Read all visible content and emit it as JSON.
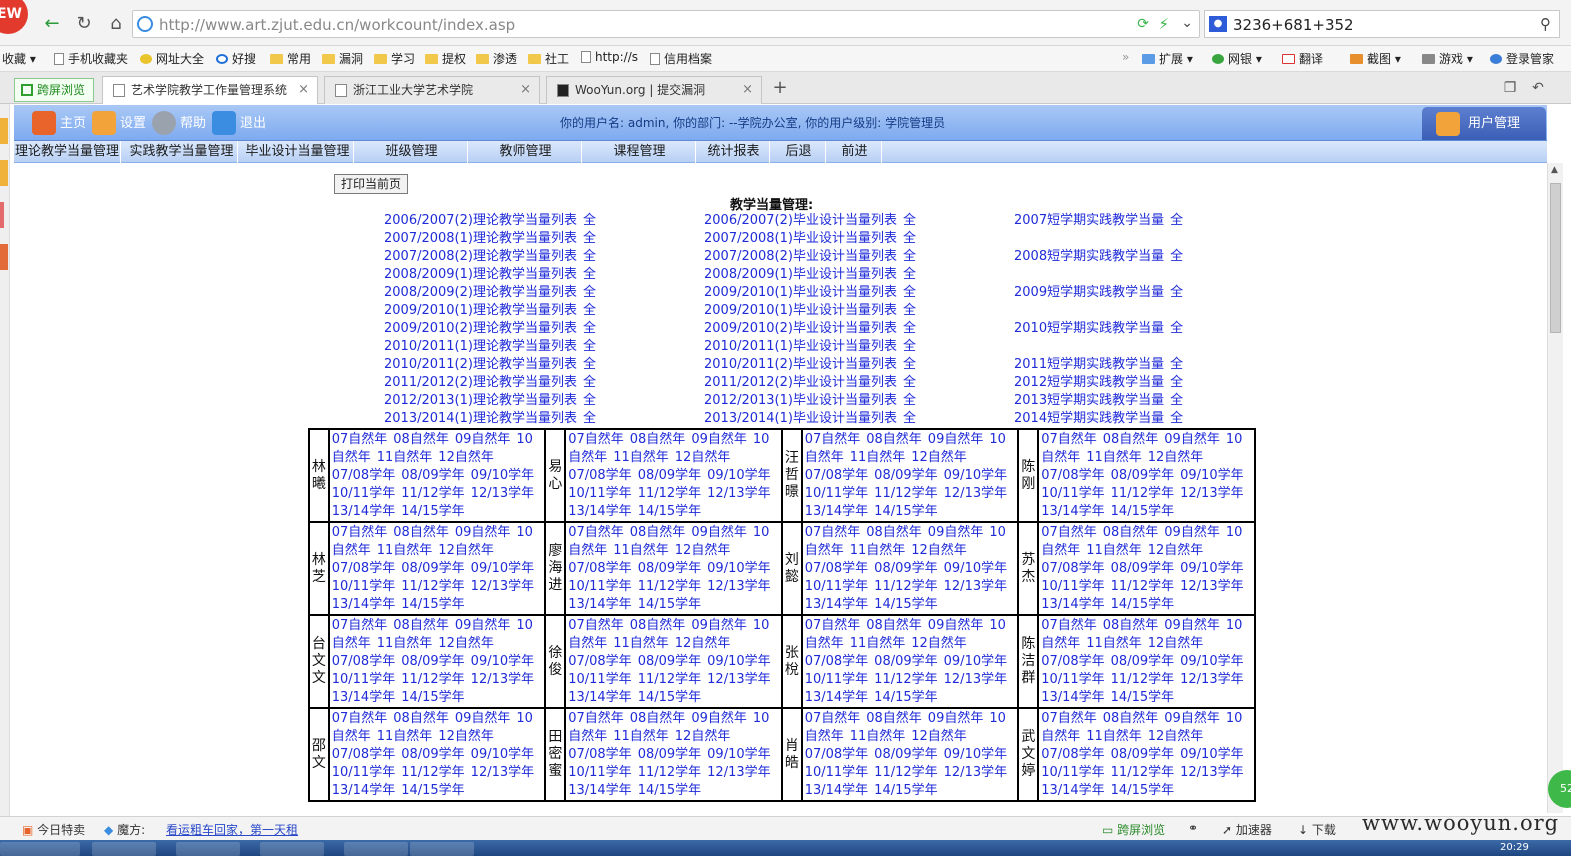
{
  "browser": {
    "url": "http://www.art.zjut.edu.cn/workcount/index.asp",
    "search_text": "3236+681+352",
    "bookmarks": [
      "收藏",
      "手机收藏夹",
      "网址大全",
      "好搜",
      "常用",
      "漏洞",
      "学习",
      "提权",
      "渗透",
      "社工",
      "http://s",
      "信用档案"
    ],
    "right_tools": [
      "扩展",
      "网银",
      "翻译",
      "截图",
      "游戏",
      "登录管家"
    ],
    "kuaping": "跨屏浏览",
    "tabs": [
      {
        "title": "艺术学院教学工作量管理系统",
        "active": true
      },
      {
        "title": "浙江工业大学艺术学院",
        "active": false
      },
      {
        "title": "WooYun.org | 提交漏洞",
        "active": false
      }
    ]
  },
  "app": {
    "header_buttons": [
      "主页",
      "设置",
      "帮助",
      "退出"
    ],
    "user_info": "你的用户名: admin, 你的部门: --学院办公室, 你的用户级别: 学院管理员",
    "user_mgmt": "用户管理",
    "menu": [
      "理论教学当量管理",
      "实践教学当量管理",
      "毕业设计当量管理",
      "班级管理",
      "教师管理",
      "课程管理",
      "统计报表",
      "后退",
      "前进"
    ],
    "print_button": "打印当前页",
    "page_title": "教学当量管理:",
    "all_label": "全",
    "theory_links": [
      "2006/2007(2)理论教学当量列表",
      "2007/2008(1)理论教学当量列表",
      "2007/2008(2)理论教学当量列表",
      "2008/2009(1)理论教学当量列表",
      "2008/2009(2)理论教学当量列表",
      "2009/2010(1)理论教学当量列表",
      "2009/2010(2)理论教学当量列表",
      "2010/2011(1)理论教学当量列表",
      "2010/2011(2)理论教学当量列表",
      "2011/2012(2)理论教学当量列表",
      "2012/2013(1)理论教学当量列表",
      "2013/2014(1)理论教学当量列表"
    ],
    "design_links": [
      "2006/2007(2)毕业设计当量列表",
      "2007/2008(1)毕业设计当量列表",
      "2007/2008(2)毕业设计当量列表",
      "2008/2009(1)毕业设计当量列表",
      "2009/2010(1)毕业设计当量列表",
      "2009/2010(1)毕业设计当量列表",
      "2009/2010(2)毕业设计当量列表",
      "2010/2011(1)毕业设计当量列表",
      "2010/2011(2)毕业设计当量列表",
      "2011/2012(2)毕业设计当量列表",
      "2012/2013(1)毕业设计当量列表",
      "2013/2014(1)毕业设计当量列表"
    ],
    "practice_links": [
      "2007短学期实践教学当量",
      "",
      "2008短学期实践教学当量",
      "",
      "2009短学期实践教学当量",
      "",
      "2010短学期实践教学当量",
      "",
      "2011短学期实践教学当量",
      "2012短学期实践教学当量",
      "2013短学期实践教学当量",
      "2014短学期实践教学当量"
    ],
    "cell_lines": [
      [
        "07自然年",
        "08自然年",
        "09自然年",
        "10"
      ],
      [
        "自然年",
        "11自然年",
        "12自然年"
      ],
      [
        "07/08学年",
        "08/09学年",
        "09/10学年"
      ],
      [
        "10/11学年",
        "11/12学年",
        "12/13学年"
      ],
      [
        "13/14学年",
        "14/15学年"
      ]
    ],
    "teachers": [
      [
        "林曦",
        "易心",
        "汪哲暻",
        "陈刚"
      ],
      [
        "林芝",
        "廖海进",
        "刘懿",
        "苏杰"
      ],
      [
        "台文文",
        "徐俊",
        "张梲",
        "陈洁群"
      ],
      [
        "邵文",
        "田密蜜",
        "肖皓",
        "武文婷"
      ]
    ]
  },
  "status": {
    "items": [
      "今日特卖",
      "魔方:"
    ],
    "news_link": "看运粗车回家，第一天租",
    "right_items": [
      "跨屏浏览",
      "加速器",
      "下载"
    ],
    "watermark": "www.wooyun.org",
    "float_ball": "52",
    "clock": "20:29"
  }
}
